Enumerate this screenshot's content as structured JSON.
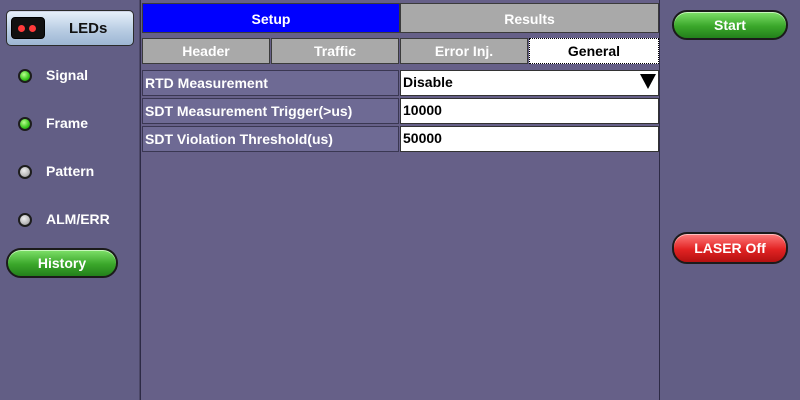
{
  "sidebar": {
    "leds_label": "LEDs",
    "leds": [
      {
        "label": "Signal",
        "state": "green"
      },
      {
        "label": "Frame",
        "state": "green"
      },
      {
        "label": "Pattern",
        "state": "gray"
      },
      {
        "label": "ALM/ERR",
        "state": "gray"
      }
    ],
    "history_label": "History"
  },
  "tabs": {
    "setup": "Setup",
    "results": "Results",
    "active": "Setup"
  },
  "subtabs": {
    "header": "Header",
    "traffic": "Traffic",
    "error_inj": "Error Inj.",
    "general": "General",
    "active": "General"
  },
  "fields": [
    {
      "label": "RTD Measurement",
      "value": "Disable"
    },
    {
      "label": "SDT Measurement Trigger(>us)",
      "value": "10000"
    },
    {
      "label": "SDT Violation Threshold(us)",
      "value": "50000"
    }
  ],
  "actions": {
    "start_label": "Start",
    "laser_label": "LASER Off"
  },
  "colors": {
    "background": "#6a6688",
    "active_tab": "#0000ff",
    "inactive_tab": "#a9a9a9",
    "start_button": "#3aa72a",
    "laser_button": "#e22323"
  }
}
